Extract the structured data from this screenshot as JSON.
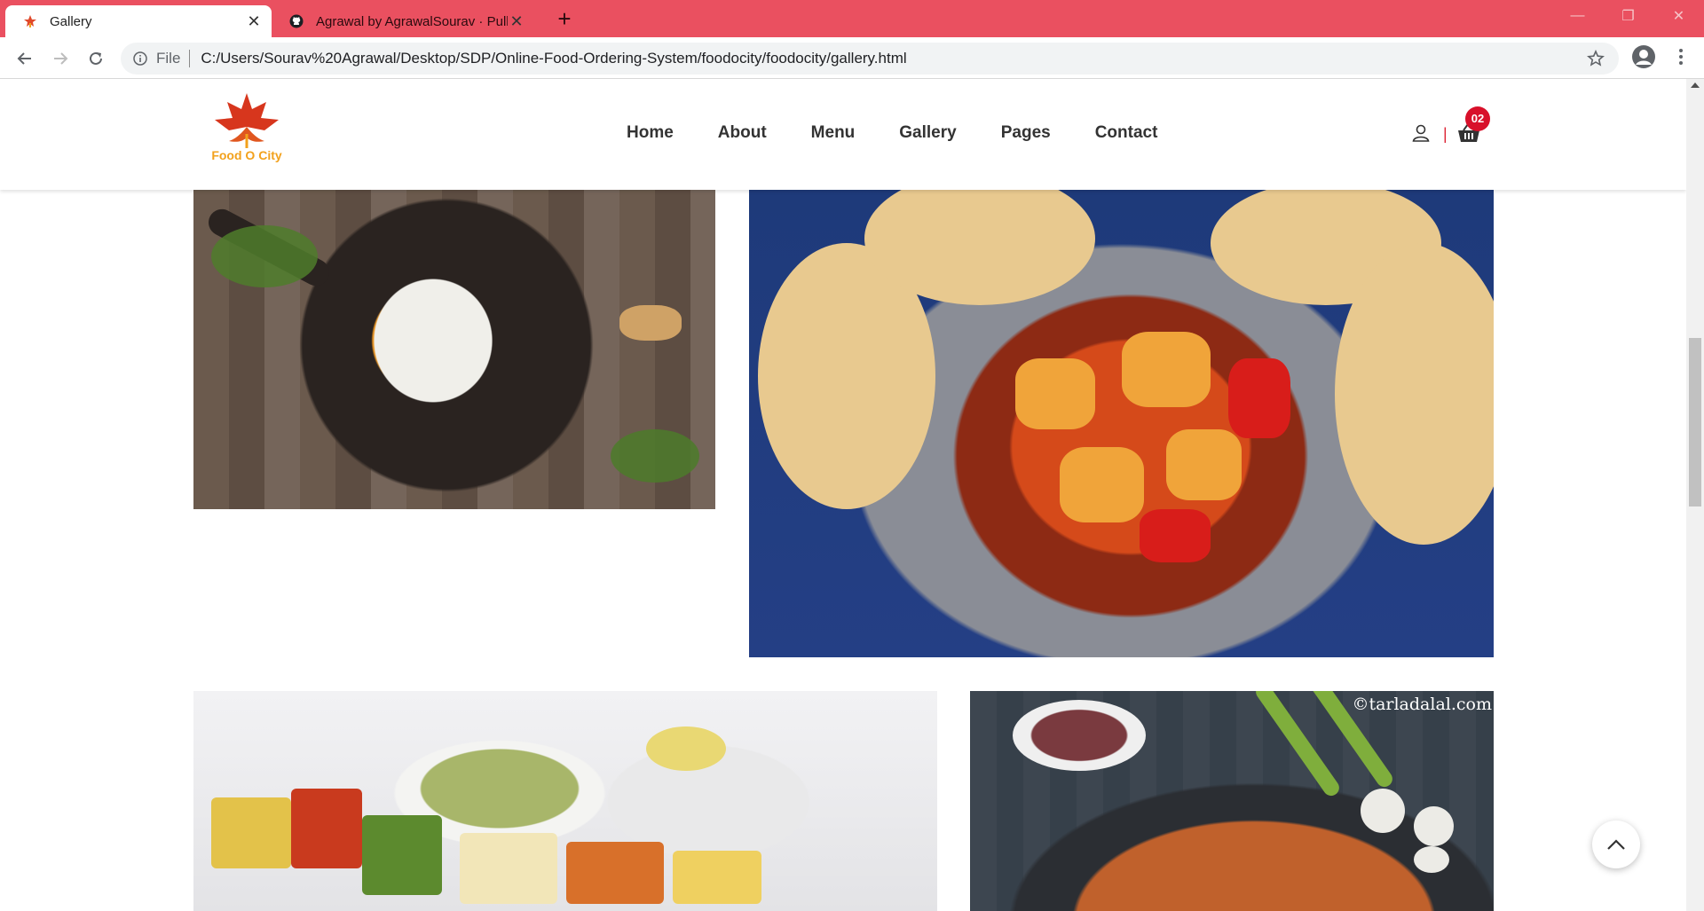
{
  "browser": {
    "tabs": [
      {
        "title": "Gallery",
        "active": true
      },
      {
        "title": "Agrawal by AgrawalSourav · Pull",
        "active": false
      }
    ],
    "close_glyph": "✕",
    "new_tab_glyph": "+",
    "window_controls": [
      "—",
      "❐",
      "✕"
    ],
    "address": {
      "scheme_label": "File",
      "url": "C:/Users/Sourav%20Agrawal/Desktop/SDP/Online-Food-Ordering-System/foodocity/foodocity/gallery.html"
    }
  },
  "site": {
    "logo_text": "Food O City",
    "nav": [
      "Home",
      "About",
      "Menu",
      "Gallery",
      "Pages",
      "Contact"
    ],
    "header_separator": "|",
    "cart_count": "02",
    "gallery": {
      "watermark": "©tarladalal.com"
    }
  },
  "colors": {
    "tab_bar": "#ea5060",
    "cart_badge": "#d8102a",
    "logo_text": "#f2a11c"
  }
}
